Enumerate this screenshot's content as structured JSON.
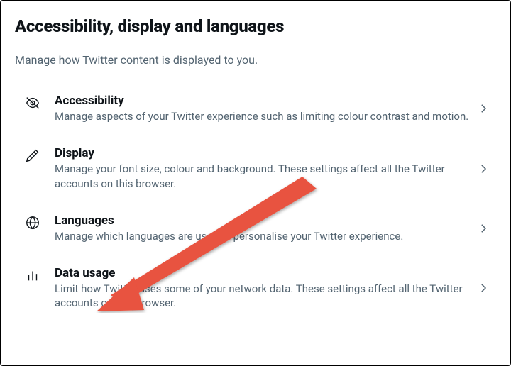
{
  "header": {
    "title": "Accessibility, display and languages",
    "subtitle": "Manage how Twitter content is displayed to you."
  },
  "items": [
    {
      "icon": "eye-off",
      "title": "Accessibility",
      "desc": "Manage aspects of your Twitter experience such as limiting colour contrast and motion."
    },
    {
      "icon": "brush",
      "title": "Display",
      "desc": "Manage your font size, colour and background. These settings affect all the Twitter accounts on this browser."
    },
    {
      "icon": "globe",
      "title": "Languages",
      "desc": "Manage which languages are used to personalise your Twitter experience."
    },
    {
      "icon": "bars",
      "title": "Data usage",
      "desc": "Limit how Twitter uses some of your network data. These settings affect all the Twitter accounts on this browser."
    }
  ],
  "annotation": {
    "color": "#e8523f"
  }
}
